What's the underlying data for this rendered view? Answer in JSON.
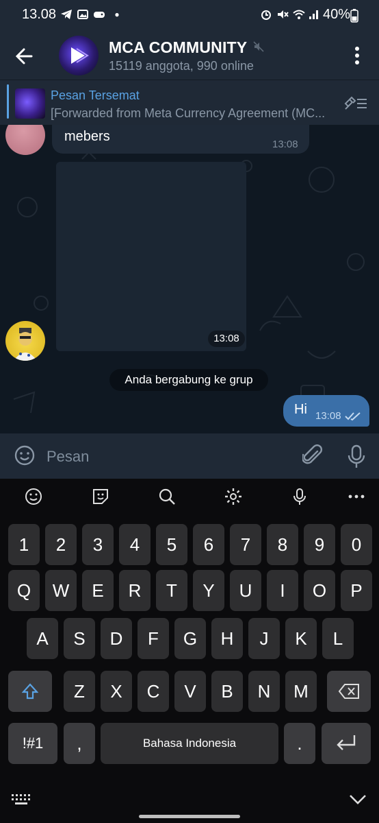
{
  "status_bar": {
    "time": "13.08",
    "battery": "40%"
  },
  "header": {
    "title": "MCA COMMUNITY",
    "subtitle": "15119 anggota, 990 online"
  },
  "pinned": {
    "title": "Pesan Tersemat",
    "text": "[Forwarded from Meta Currency Agreement (MC..."
  },
  "messages": [
    {
      "text": "mebers",
      "time": "13:08"
    },
    {
      "media_time": "13:08"
    }
  ],
  "service_message": "Anda bergabung ke grup",
  "outgoing": {
    "text": "Hi",
    "time": "13:08"
  },
  "composer": {
    "placeholder": "Pesan"
  },
  "keyboard": {
    "rows": [
      [
        "1",
        "2",
        "3",
        "4",
        "5",
        "6",
        "7",
        "8",
        "9",
        "0"
      ],
      [
        "Q",
        "W",
        "E",
        "R",
        "T",
        "Y",
        "U",
        "I",
        "O",
        "P"
      ],
      [
        "A",
        "S",
        "D",
        "F",
        "G",
        "H",
        "J",
        "K",
        "L"
      ],
      [
        "Z",
        "X",
        "C",
        "V",
        "B",
        "N",
        "M"
      ]
    ],
    "symbols_key": "!#1",
    "comma_key": ",",
    "space_label": "Bahasa Indonesia",
    "period_key": "."
  },
  "colors": {
    "accent": "#5aa2e3",
    "outgoing_bubble": "#3a6fa8",
    "header_bg": "#1f2936",
    "chat_bg": "#0f1822"
  }
}
